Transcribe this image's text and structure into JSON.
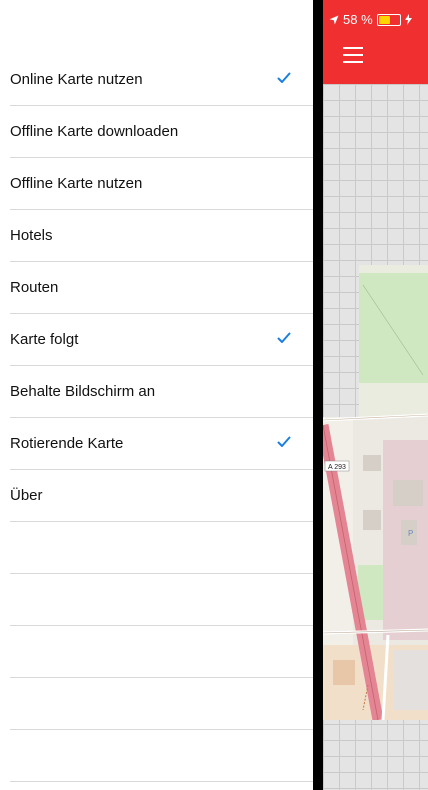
{
  "menu": {
    "items": [
      {
        "label": "Online Karte nutzen",
        "checked": true
      },
      {
        "label": "Offline Karte downloaden",
        "checked": false
      },
      {
        "label": "Offline Karte nutzen",
        "checked": false
      },
      {
        "label": "Hotels",
        "checked": false
      },
      {
        "label": "Routen",
        "checked": false
      },
      {
        "label": "Karte folgt",
        "checked": true
      },
      {
        "label": "Behalte Bildschirm an",
        "checked": false
      },
      {
        "label": "Rotierende Karte",
        "checked": true
      },
      {
        "label": "Über",
        "checked": false
      },
      {
        "label": "",
        "checked": false
      },
      {
        "label": "",
        "checked": false
      },
      {
        "label": "",
        "checked": false
      },
      {
        "label": "",
        "checked": false
      },
      {
        "label": "",
        "checked": false
      }
    ],
    "check_icon": "checkmark-icon",
    "check_color": "#1a7fe0"
  },
  "status_bar": {
    "battery_text": "58 %",
    "battery_level": 0.58,
    "battery_color": "#ffd400",
    "icons": [
      "location-arrow-icon",
      "battery-icon",
      "charging-bolt-icon"
    ]
  },
  "map": {
    "header_color": "#f03030",
    "menu_icon": "hamburger-menu-icon",
    "road_label": "A 293"
  }
}
